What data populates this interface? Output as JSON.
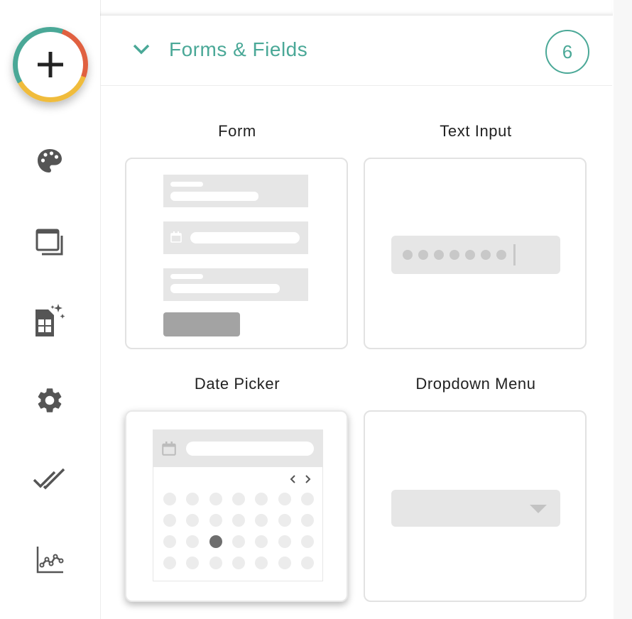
{
  "section": {
    "title": "Forms & Fields",
    "count": "6",
    "collapse_icon": "chevron-down-icon"
  },
  "rail": {
    "items": [
      {
        "name": "add-icon"
      },
      {
        "name": "palette-icon"
      },
      {
        "name": "layers-icon"
      },
      {
        "name": "magic-table-icon"
      },
      {
        "name": "settings-icon"
      },
      {
        "name": "double-check-icon"
      },
      {
        "name": "line-chart-icon"
      }
    ]
  },
  "cards": [
    {
      "label": "Form"
    },
    {
      "label": "Text Input"
    },
    {
      "label": "Date Picker"
    },
    {
      "label": "Dropdown Menu"
    }
  ],
  "colors": {
    "accent": "#4aa897",
    "ring_red": "#e06040",
    "ring_yellow": "#f0bc3c",
    "icon_gray": "#555555",
    "placeholder_gray": "#e6e6e6"
  }
}
